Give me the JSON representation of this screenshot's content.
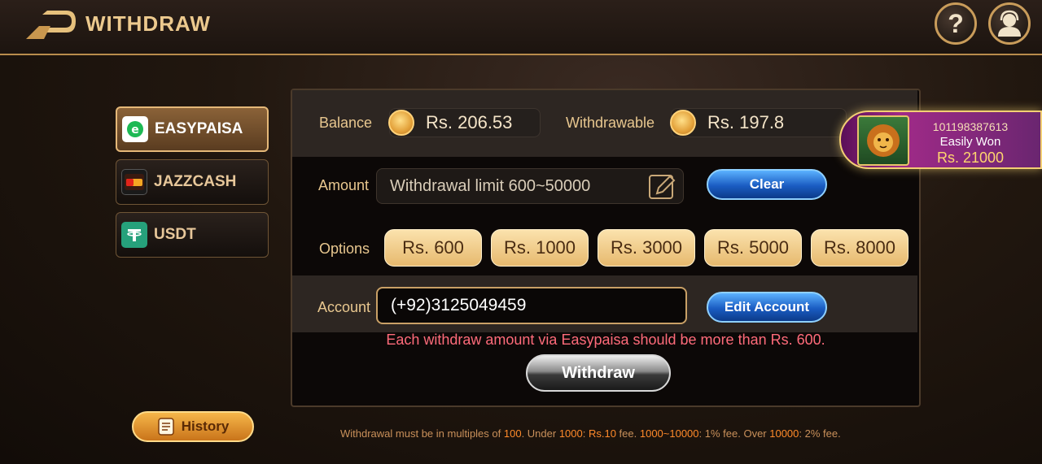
{
  "header": {
    "title": "WITHDRAW",
    "back_icon": "back-arrow-icon",
    "help_icon": "help-icon",
    "profile_icon": "customer-service-icon",
    "help_glyph": "?"
  },
  "methods": [
    {
      "label": "EASYPAISA",
      "icon": "easypaisa-logo-icon",
      "active": true
    },
    {
      "label": "JAZZCASH",
      "icon": "jazzcash-logo-icon",
      "active": false
    },
    {
      "label": "USDT",
      "icon": "tether-logo-icon",
      "active": false
    }
  ],
  "balance": {
    "label": "Balance",
    "value": "Rs. 206.53"
  },
  "withdrawable": {
    "label": "Withdrawable",
    "value": "Rs. 197.8"
  },
  "amount": {
    "label": "Amount",
    "placeholder": "Withdrawal limit 600~50000",
    "clear_label": "Clear"
  },
  "options": {
    "label": "Options",
    "items": [
      "Rs. 600",
      "Rs. 1000",
      "Rs. 3000",
      "Rs. 5000",
      "Rs. 8000"
    ]
  },
  "account": {
    "label": "Account",
    "value": "(+92)3125049459",
    "edit_label": "Edit Account"
  },
  "warning": "Each withdraw amount via Easypaisa should be more than Rs. 600.",
  "withdraw_button": "Withdraw",
  "history_button": "History",
  "footer": {
    "p1": "Withdrawal must be in multiples of ",
    "v1": "100",
    "p2": ".   Under ",
    "v2": "1000",
    "p3": ": ",
    "v3": "Rs.10",
    "p4": " fee.   ",
    "v4": "1000~10000",
    "p5": ": 1% fee.   Over ",
    "v5": "10000",
    "p6": ": 2% fee."
  },
  "winner": {
    "id": "101198387613",
    "text": "Easily Won",
    "amount": "Rs. 21000"
  },
  "colors": {
    "accent_gold": "#e8c78f",
    "warning_red": "#ff6b7a",
    "button_blue": "#1a5cc2",
    "history_orange": "#e8951f"
  }
}
